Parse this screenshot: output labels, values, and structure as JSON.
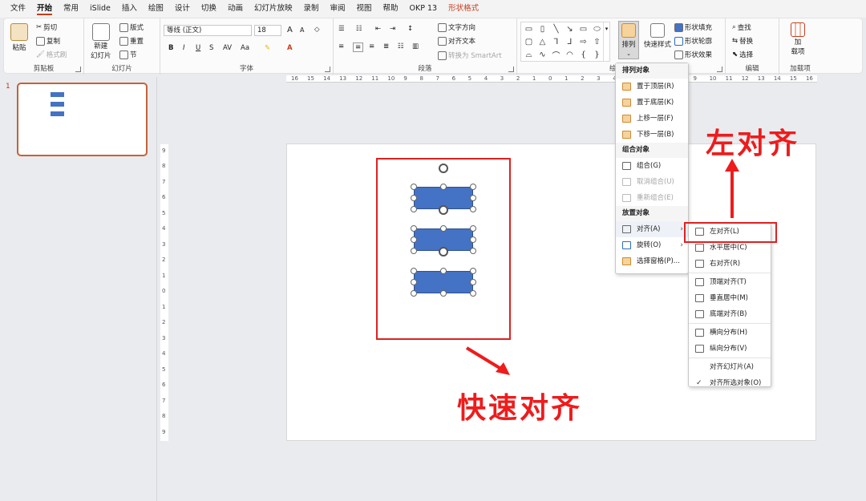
{
  "menubar": {
    "tabs": [
      "文件",
      "开始",
      "常用",
      "iSlide",
      "插入",
      "绘图",
      "设计",
      "切换",
      "动画",
      "幻灯片放映",
      "录制",
      "审阅",
      "视图",
      "帮助",
      "OKP 13",
      "形状格式"
    ],
    "active_tab": "开始",
    "contextual_tab": "形状格式"
  },
  "ribbon": {
    "clipboard": {
      "paste": "粘贴",
      "cut": "剪切",
      "copy": "复制",
      "format_painter": "格式刷",
      "label": "剪贴板"
    },
    "slides": {
      "new_slide_line1": "新建",
      "new_slide_line2": "幻灯片",
      "layout": "版式",
      "reset": "重置",
      "section": "节",
      "label": "幻灯片"
    },
    "font": {
      "family": "等线 (正文)",
      "size": "18",
      "label": "字体",
      "bold": "B",
      "italic": "I",
      "underline": "U",
      "strike": "S",
      "grow": "A",
      "shrink": "A",
      "case": "Aa"
    },
    "paragraph": {
      "text_direction": "文字方向",
      "align_text": "对齐文本",
      "smartart": "转换为 SmartArt",
      "label": "段落"
    },
    "drawing": {
      "arrange": "排列",
      "quick_styles": "快速样式",
      "shape_fill": "形状填充",
      "shape_outline": "形状轮廓",
      "shape_effects": "形状效果",
      "label": "绘"
    },
    "editing": {
      "find": "查找",
      "replace": "替换",
      "select": "选择",
      "label": "编辑"
    },
    "addins": {
      "addins_line1": "加",
      "addins_line2": "载项",
      "label": "加载项"
    }
  },
  "thumbnails": {
    "slide_number": "1"
  },
  "rulers": {
    "h_ticks": [
      "16",
      "15",
      "14",
      "13",
      "12",
      "11",
      "10",
      "9",
      "8",
      "7",
      "6",
      "5",
      "4",
      "3",
      "2",
      "1",
      "0",
      "1",
      "2",
      "3",
      "4",
      "5",
      "6",
      "7",
      "8",
      "9",
      "10",
      "11",
      "12",
      "13",
      "14",
      "15",
      "16"
    ],
    "v_ticks": [
      "9",
      "8",
      "7",
      "6",
      "5",
      "4",
      "3",
      "2",
      "1",
      "0",
      "1",
      "2",
      "3",
      "4",
      "5",
      "6",
      "7",
      "8",
      "9"
    ]
  },
  "arrange_menu": {
    "header_order": "排列对象",
    "bring_to_front": "置于顶层(R)",
    "send_to_back": "置于底层(K)",
    "bring_forward": "上移一层(F)",
    "send_backward": "下移一层(B)",
    "header_group": "组合对象",
    "group": "组合(G)",
    "ungroup": "取消组合(U)",
    "regroup": "重新组合(E)",
    "header_position": "放置对象",
    "align": "对齐(A)",
    "rotate": "旋转(O)",
    "selection_pane": "选择窗格(P)..."
  },
  "align_menu": {
    "align_left": "左对齐(L)",
    "align_center": "水平居中(C)",
    "align_right": "右对齐(R)",
    "align_top": "顶端对齐(T)",
    "align_middle": "垂直居中(M)",
    "align_bottom": "底端对齐(B)",
    "distribute_h": "横向分布(H)",
    "distribute_v": "纵向分布(V)",
    "align_to_slide": "对齐幻灯片(A)",
    "align_selected": "对齐所选对象(O)"
  },
  "annotations": {
    "left_align_callout": "左对齐",
    "quick_align_callout": "快速对齐"
  },
  "colors": {
    "accent": "#c43e1c",
    "shape_fill": "#4472c4",
    "annotation_red": "#ee1c1c"
  }
}
